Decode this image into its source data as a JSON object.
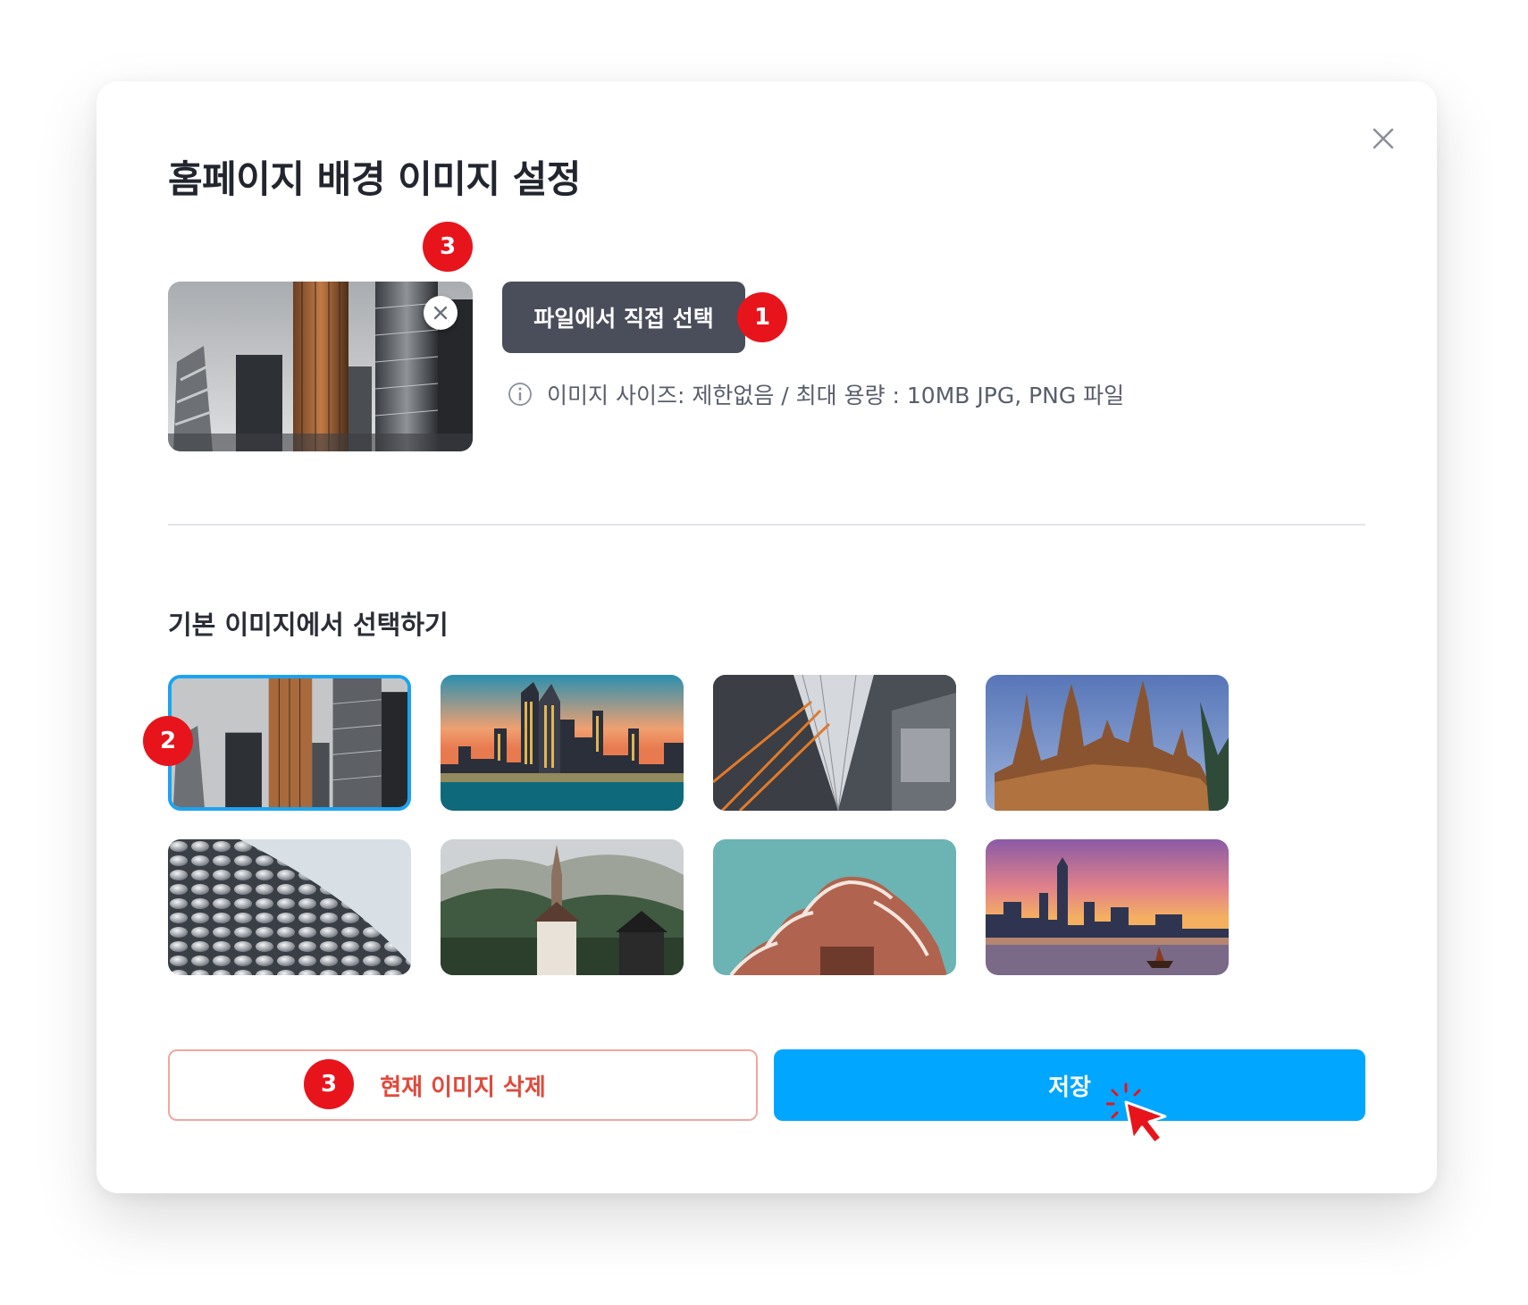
{
  "modal": {
    "title": "홈페이지 배경 이미지 설정"
  },
  "upload": {
    "file_button_label": "파일에서 직접 선택",
    "info_text": "이미지 사이즈: 제한없음 / 최대 용량 : 10MB JPG, PNG 파일"
  },
  "defaults": {
    "section_title": "기본 이미지에서 선택하기",
    "selected_index": 0,
    "images": [
      {
        "icon": "skyscrapers-gray"
      },
      {
        "icon": "city-skyline-sunset"
      },
      {
        "icon": "tower-upward-view"
      },
      {
        "icon": "castle"
      },
      {
        "icon": "dotted-facade"
      },
      {
        "icon": "mountain-church"
      },
      {
        "icon": "curved-balconies"
      },
      {
        "icon": "harbor-skyline-dusk"
      }
    ]
  },
  "actions": {
    "delete_label": "현재 이미지 삭제",
    "save_label": "저장"
  },
  "annotations": {
    "badge_file": "1",
    "badge_select": "2",
    "badge_remove": "3",
    "badge_delete": "3"
  },
  "colors": {
    "accent": "#00a6ff",
    "danger": "#e04a3c",
    "badge": "#e8141b",
    "dark_button": "#4a4d5a"
  }
}
